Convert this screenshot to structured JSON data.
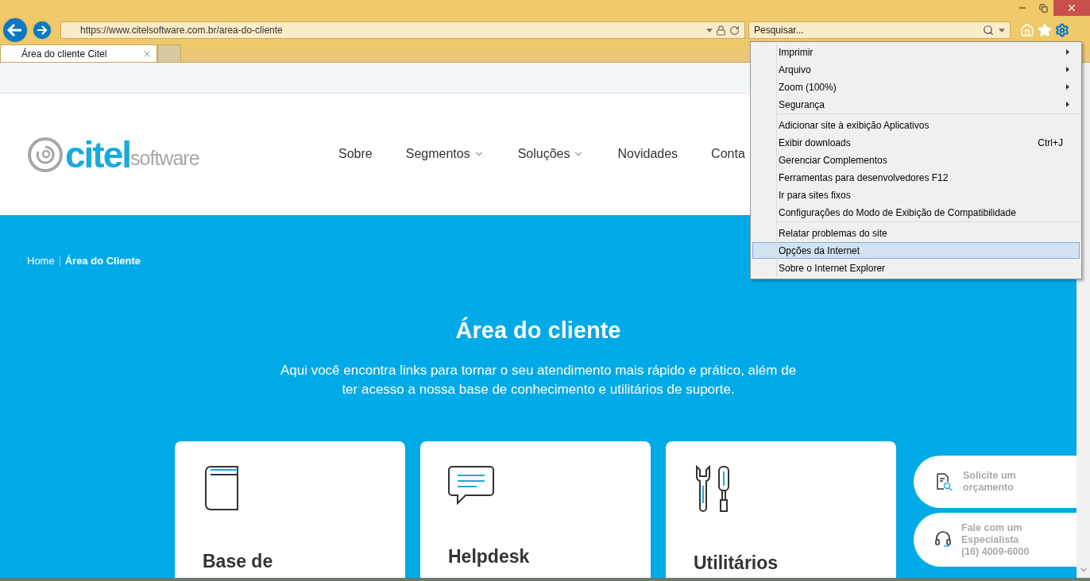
{
  "browser": {
    "url": "https://www.citelsoftware.com.br/area-do-cliente",
    "search": {
      "placeholder": "Pesquisar..."
    },
    "tabs": [
      {
        "title": "Área do cliente Citel",
        "selected": true
      }
    ]
  },
  "menu": {
    "sections": [
      [
        {
          "label": "Imprimir",
          "submenu": true,
          "selected": false
        },
        {
          "label": "Arquivo",
          "submenu": true,
          "selected": false
        },
        {
          "label": "Zoom (100%)",
          "submenu": true,
          "selected": false
        },
        {
          "label": "Segurança",
          "submenu": true,
          "selected": false
        }
      ],
      [
        {
          "label": "Adicionar site à exibição Aplicativos",
          "submenu": false,
          "selected": false
        },
        {
          "label": "Exibir downloads",
          "shortcut": "Ctrl+J",
          "submenu": false,
          "selected": false
        },
        {
          "label": "Gerenciar Complementos",
          "submenu": false,
          "selected": false
        },
        {
          "label": "Ferramentas para desenvolvedores F12",
          "submenu": false,
          "selected": false
        },
        {
          "label": "Ir para sites fixos",
          "submenu": false,
          "selected": false
        },
        {
          "label": "Configurações do Modo de Exibição de Compatibilidade",
          "submenu": false,
          "selected": false
        }
      ],
      [
        {
          "label": "Relatar problemas do site",
          "submenu": false,
          "selected": false
        },
        {
          "label": "Opções da Internet",
          "submenu": false,
          "selected": true
        },
        {
          "label": "Sobre o Internet Explorer",
          "submenu": false,
          "selected": false
        }
      ]
    ]
  },
  "site": {
    "logo": {
      "main": "citel",
      "sub": "software"
    },
    "nav": [
      {
        "label": "Sobre",
        "dropdown": false
      },
      {
        "label": "Segmentos",
        "dropdown": true
      },
      {
        "label": "Soluções",
        "dropdown": true
      },
      {
        "label": "Novidades",
        "dropdown": false
      },
      {
        "label": "Conta",
        "dropdown": false
      }
    ],
    "breadcrumb": [
      {
        "label": "Home",
        "current": false
      },
      {
        "label": "Área do Cliente",
        "current": true
      }
    ],
    "hero": {
      "title": "Área do cliente",
      "text": "Aqui você encontra links para tornar o seu atendimento mais rápido e prático, além de ter acesso a nossa base de conhecimento e utilitários de suporte."
    },
    "cards": [
      {
        "kind": "book",
        "title": "Base de"
      },
      {
        "kind": "chat",
        "title": "Helpdesk"
      },
      {
        "kind": "tools",
        "title": "Utilitários"
      }
    ],
    "side_buttons": [
      {
        "kind": "quote",
        "text": "Solicite um orçamento"
      },
      {
        "kind": "support",
        "text": "Fale com um Especialista",
        "phone": "(16) 4009-6000"
      }
    ]
  }
}
